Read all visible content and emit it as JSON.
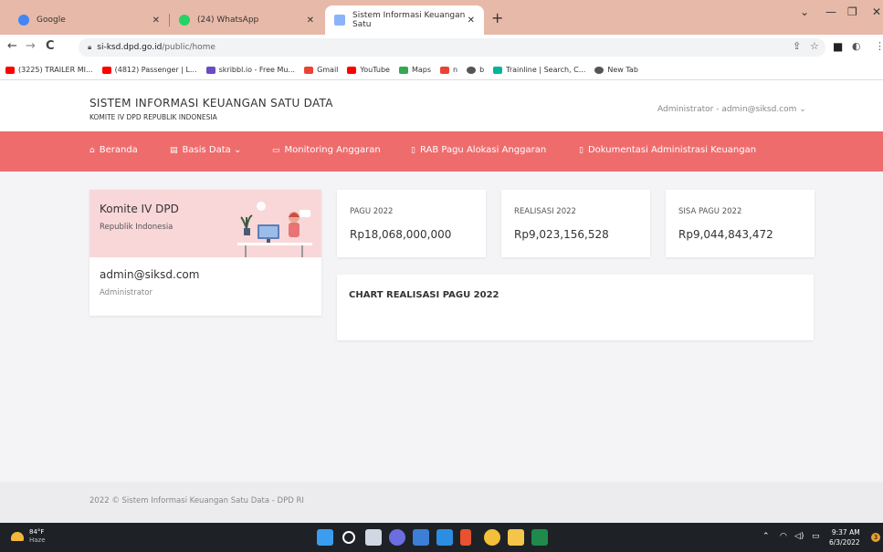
{
  "browser": {
    "tabs": [
      {
        "title": "Google",
        "favicon_color": "#4285f4"
      },
      {
        "title": "(24) WhatsApp",
        "favicon_color": "#25d366"
      },
      {
        "title": "Sistem Informasi Keuangan Satu",
        "favicon_color": "#8ab4f8"
      }
    ],
    "new_tab_label": "+",
    "url_host": "si-ksd.dpd.go.id",
    "url_path": "/public/home",
    "bookmarks": [
      {
        "label": "(3225) TRAILER MI...",
        "icon_color": "#ff0000"
      },
      {
        "label": "(4812) Passenger | L...",
        "icon_color": "#ff0000"
      },
      {
        "label": "skribbl.io - Free Mu...",
        "icon_color": "#6a4bc4"
      },
      {
        "label": "Gmail",
        "icon_color": "#ea4335"
      },
      {
        "label": "YouTube",
        "icon_color": "#ff0000"
      },
      {
        "label": "Maps",
        "icon_color": "#34a853"
      },
      {
        "label": "n",
        "icon_color": "#ea4335"
      },
      {
        "label": "b",
        "icon_color": "#555555"
      },
      {
        "label": "Trainline | Search, C...",
        "icon_color": "#00b59b"
      },
      {
        "label": "New Tab",
        "icon_color": "#555555"
      }
    ]
  },
  "app": {
    "title": "SISTEM INFORMASI KEUANGAN SATU DATA",
    "subtitle": "KOMITE IV DPD REPUBLIK INDONESIA",
    "user_menu": "Administrator - admin@siksd.com",
    "accent_color": "#ef6c6d",
    "nav": [
      {
        "label": "Beranda",
        "icon": "home-icon"
      },
      {
        "label": "Basis Data",
        "icon": "database-icon"
      },
      {
        "label": "Monitoring Anggaran",
        "icon": "monitor-icon"
      },
      {
        "label": "RAB Pagu Alokasi Anggaran",
        "icon": "document-icon"
      },
      {
        "label": "Dokumentasi Administrasi Keuangan",
        "icon": "document-icon"
      }
    ]
  },
  "profile": {
    "title": "Komite IV DPD",
    "subtitle": "Republik Indonesia",
    "email": "admin@siksd.com",
    "role": "Administrator"
  },
  "stats": [
    {
      "label": "PAGU 2022",
      "value": "Rp18,068,000,000"
    },
    {
      "label": "REALISASI 2022",
      "value": "Rp9,023,156,528"
    },
    {
      "label": "SISA PAGU 2022",
      "value": "Rp9,044,843,472"
    }
  ],
  "chart_card": {
    "title": "CHART REALISASI PAGU 2022"
  },
  "footer": {
    "text": "2022 © Sistem Informasi Keuangan Satu Data - DPD RI"
  },
  "taskbar": {
    "temperature": "84°F",
    "weather": "Haze",
    "time": "9:37 AM",
    "date": "6/3/2022",
    "notification_count": "3"
  }
}
